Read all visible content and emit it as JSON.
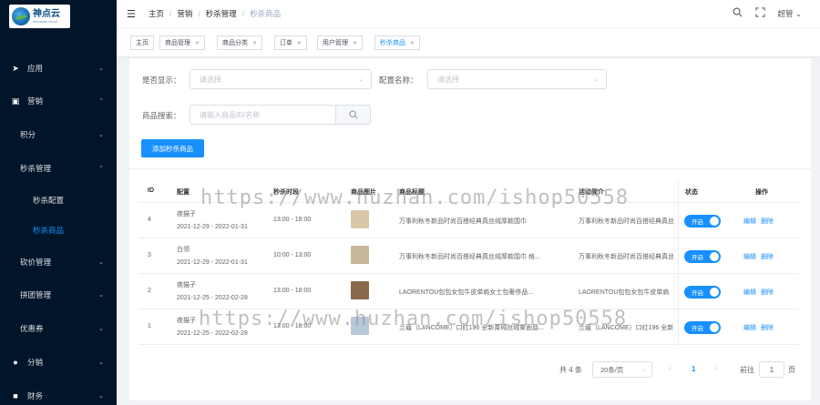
{
  "logo": {
    "name_cn": "神点云",
    "name_en": "shendian.cloud"
  },
  "sidebar": {
    "items": [
      {
        "label": "应用",
        "icon": "send-icon",
        "arrow": "⌄"
      },
      {
        "label": "营销",
        "icon": "chart-icon",
        "arrow": "⌃"
      },
      {
        "label": "积分",
        "arrow": "⌄"
      },
      {
        "label": "秒杀管理",
        "arrow": "⌃"
      },
      {
        "label": "秒杀配置"
      },
      {
        "label": "秒杀商品"
      },
      {
        "label": "砍价管理",
        "arrow": "⌄"
      },
      {
        "label": "拼团管理",
        "arrow": "⌄"
      },
      {
        "label": "优惠券",
        "arrow": "⌄"
      },
      {
        "label": "分销",
        "icon": "user-icon",
        "arrow": "⌄"
      },
      {
        "label": "财务",
        "icon": "wallet-icon",
        "arrow": "⌄"
      }
    ]
  },
  "header": {
    "breadcrumb": [
      "主页",
      "营销",
      "秒杀管理",
      "秒杀商品"
    ],
    "user": "超管 ⌄"
  },
  "tags": [
    {
      "label": "主页",
      "closable": false
    },
    {
      "label": "商品管理",
      "closable": true
    },
    {
      "label": "商品分类",
      "closable": true
    },
    {
      "label": "订单",
      "closable": true
    },
    {
      "label": "用户管理",
      "closable": true
    },
    {
      "label": "秒杀商品",
      "closable": true
    }
  ],
  "filters": {
    "display_label": "是否显示：",
    "display_placeholder": "请选择",
    "config_label": "配置名称：",
    "config_placeholder": "请选择",
    "search_label": "商品搜索：",
    "search_placeholder": "请输入商品ID/名称",
    "add_button": "添加秒杀商品"
  },
  "table": {
    "headers": [
      "ID",
      "配置",
      "秒杀时段",
      "商品图片",
      "商品标题",
      "活动简介",
      "状态",
      "操作"
    ],
    "rows": [
      {
        "id": "4",
        "config_name": "夜猫子",
        "config_dates": "2021-12-29 - 2022-01-31",
        "time": "13:00 - 18:00",
        "title": "万事利秋冬新品时尚百搭经典真丝绒厚款围巾",
        "intro": "万事利秋冬新品时尚百搭经典真丝",
        "status": "开启",
        "edit": "编辑",
        "delete": "删除",
        "thumb_color": "#d9c8a8"
      },
      {
        "id": "3",
        "config_name": "白领",
        "config_dates": "2021-12-29 - 2022-01-31",
        "time": "10:00 - 13:00",
        "title": "万事利秋冬新品时尚百搭经典真丝绒厚款围巾 格...",
        "intro": "万事利秋冬新品时尚百搭经典真丝",
        "status": "开启",
        "edit": "编辑",
        "delete": "删除",
        "thumb_color": "#c8b89a"
      },
      {
        "id": "2",
        "config_name": "夜猫子",
        "config_dates": "2021-12-25 - 2022-02-28",
        "time": "13:00 - 18:00",
        "title": "LAORENTOU包包女包牛皮单肩女士包奢侈品...",
        "intro": "LAORENTOU包包女包牛皮单肩",
        "status": "开启",
        "edit": "编辑",
        "delete": "删除",
        "thumb_color": "#8a6a4a"
      },
      {
        "id": "1",
        "config_name": "夜猫子",
        "config_dates": "2021-12-25 - 2022-02-28",
        "time": "13:00 - 18:00",
        "title": "兰蔻（LANCOME）口红196 全新菁纯丝绒雾面唇...",
        "intro": "兰蔻（LANCOME）口红196 全新",
        "status": "开启",
        "edit": "编辑",
        "delete": "删除",
        "thumb_color": "#b8c8d8"
      }
    ]
  },
  "pagination": {
    "total": "共 4 条",
    "page_size": "20条/页",
    "prev": "‹",
    "current": "1",
    "next": "›",
    "goto_label": "前往",
    "goto_value": "1",
    "page_suffix": "页"
  },
  "watermark": {
    "line1": "https://www.huzhan.com/ishop50558",
    "line2": "https://www.huzhan.com/ishop50558"
  }
}
